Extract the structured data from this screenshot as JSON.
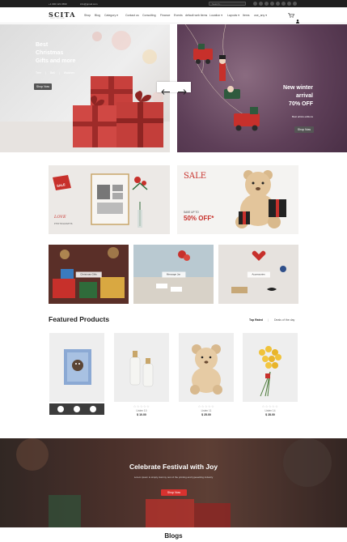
{
  "topbar": {
    "phone": "+1 000 123 4560",
    "email": "info@gmail.com",
    "search_placeholder": "Search..."
  },
  "header": {
    "logo": "SCITA",
    "logo_sub": "GIFT STORE",
    "menu": [
      "Shop",
      "Blog",
      "Category ▾",
      "Contact us",
      "Consulting",
      "Finance",
      "Events",
      "default web items",
      "Location ▾",
      "Layouts ▾",
      "Items",
      "use_any ▾"
    ]
  },
  "hero_left": {
    "title_line1": "Best",
    "title_line2": "Christmas",
    "title_line3": "Gifts and more",
    "links": [
      "Tree",
      "Ball",
      "Watches"
    ],
    "button": "Shop Now"
  },
  "hero_right": {
    "title_line1": "New winter",
    "title_line2": "arrival",
    "title_line3": "70% OFF",
    "subtitle": "Best artists editions",
    "button": "Shop Now"
  },
  "banners": {
    "left_tag": "SALE",
    "left_caption_line1": "LOVE",
    "left_caption_line2": "PHOTOGRAPHS",
    "right_sale": "SALE",
    "right_save": "SAVE UP TO",
    "right_discount": "50% OFF*"
  },
  "categories": [
    "Christmas Gifts",
    "Message Jar",
    "Accessories"
  ],
  "featured": {
    "title": "Featured Products",
    "tabs": [
      "Top Rated",
      "Deals of the day"
    ]
  },
  "products": [
    {
      "name": "",
      "price": ""
    },
    {
      "name": "Listen 10",
      "price": "$ 10.00"
    },
    {
      "name": "Listen 11",
      "price": "$ 25.00"
    },
    {
      "name": "Listen 14",
      "price": "$ 28.00"
    }
  ],
  "festival": {
    "title": "Celebrate Festival with Joy",
    "subtitle": "Lorem ipsum is simply dummy text of the printing and typesetting industry",
    "button": "Shop Now"
  },
  "blogs": {
    "title": "Blogs"
  },
  "colors": {
    "accent": "#d8322f",
    "dark": "#1f1f1f",
    "hero_right_bg": "#5e3f58"
  }
}
